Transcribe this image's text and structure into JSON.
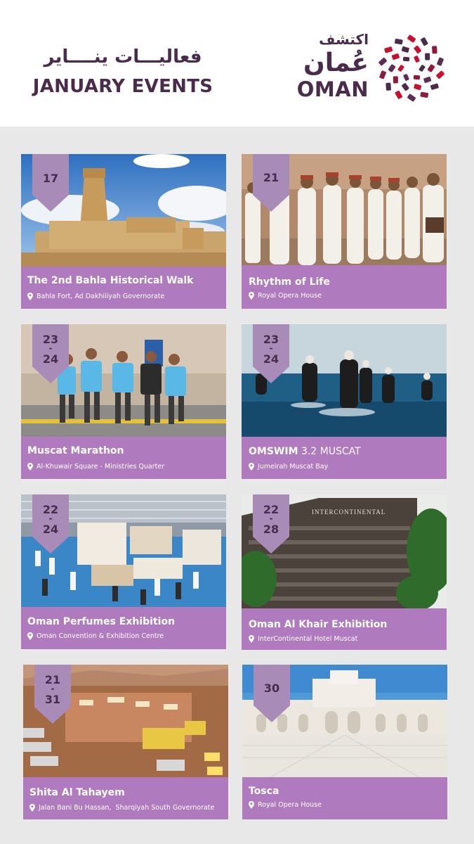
{
  "header": {
    "title_ar": "فعاليـــات ينــــاير",
    "title_en": "JANUARY EVENTS",
    "logo_ar_top": "اكتشف",
    "logo_ar_main": "عُمان",
    "logo_en": "OMAN"
  },
  "colors": {
    "brand_purple": "#4a2b4c",
    "card_purple": "#b07abf",
    "badge_purple": "#a98bb8",
    "logo_red": "#c8102e"
  },
  "events": [
    {
      "date1": "17",
      "date2": "",
      "title": "The 2nd Bahla Historical Walk",
      "location": "Bahla Fort, Ad Dakhiliyah Governorate",
      "image": "bahla-fort-photo"
    },
    {
      "date1": "21",
      "date2": "",
      "title": "Rhythm of Life",
      "location": "Royal Opera House",
      "image": "omani-dancers-photo"
    },
    {
      "date1": "23",
      "date2": "24",
      "title": "Muscat Marathon",
      "location": "Al-Khuwair Square - Ministries Quarter",
      "image": "marathon-runners-photo"
    },
    {
      "date1": "23",
      "date2": "24",
      "title_bold": "OMSWIM",
      "title_rest": " 3.2 MUSCAT",
      "location": "Jumeirah Muscat Bay",
      "image": "open-water-swimmers-photo"
    },
    {
      "date1": "22",
      "date2": "24",
      "title": "Oman Perfumes Exhibition",
      "location": "Oman Convention & Exhibition Centre",
      "image": "perfume-exhibition-hall-photo"
    },
    {
      "date1": "22",
      "date2": "28",
      "title": "Oman Al Khair Exhibition",
      "location": "InterContinental Hotel Muscat",
      "image": "intercontinental-hotel-photo",
      "sign_text": "INTERCONTINENTAL"
    },
    {
      "date1": "21",
      "date2": "31",
      "title": "Shita Al Tahayem",
      "location": "Jalan Bani Bu Hassan,  Sharqiyah South Governorate",
      "image": "desert-festival-photo"
    },
    {
      "date1": "30",
      "date2": "",
      "title": "Tosca",
      "location": "Royal Opera House",
      "image": "royal-opera-house-photo"
    }
  ]
}
